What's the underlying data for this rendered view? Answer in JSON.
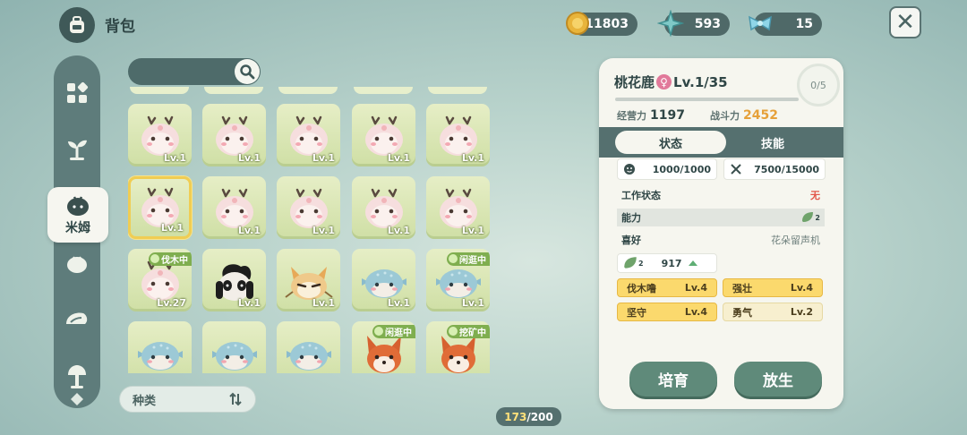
{
  "header": {
    "title": "背包",
    "currencies": [
      {
        "name": "gold-coin-icon",
        "value": "11803"
      },
      {
        "name": "star-shard-icon",
        "value": "593"
      },
      {
        "name": "bow-gem-icon",
        "value": "15"
      }
    ]
  },
  "sidebar": {
    "active_label": "米姆"
  },
  "search": {
    "placeholder": ""
  },
  "grid": {
    "items": [
      {
        "level": "Lv.1",
        "tag": "",
        "type": "deer"
      },
      {
        "level": "Lv.1",
        "tag": "",
        "type": "deer"
      },
      {
        "level": "Lv.1",
        "tag": "",
        "type": "deer"
      },
      {
        "level": "Lv.1",
        "tag": "",
        "type": "deer"
      },
      {
        "level": "Lv.1",
        "tag": "",
        "type": "deer"
      },
      {
        "level": "Lv.1",
        "tag": "",
        "type": "deer",
        "selected": true
      },
      {
        "level": "Lv.1",
        "tag": "",
        "type": "deer"
      },
      {
        "level": "Lv.1",
        "tag": "",
        "type": "deer"
      },
      {
        "level": "Lv.1",
        "tag": "",
        "type": "deer"
      },
      {
        "level": "Lv.1",
        "tag": "",
        "type": "deer"
      },
      {
        "level": "Lv.27",
        "tag": "伐木中",
        "type": "deer"
      },
      {
        "level": "Lv.1",
        "tag": "",
        "type": "panda"
      },
      {
        "level": "Lv.1",
        "tag": "",
        "type": "fox"
      },
      {
        "level": "Lv.1",
        "tag": "",
        "type": "whale"
      },
      {
        "level": "Lv.1",
        "tag": "闲逛中",
        "type": "whale"
      },
      {
        "level": "",
        "tag": "",
        "type": "whale"
      },
      {
        "level": "",
        "tag": "",
        "type": "whale"
      },
      {
        "level": "",
        "tag": "",
        "type": "whale"
      },
      {
        "level": "",
        "tag": "闲逛中",
        "type": "redfox"
      },
      {
        "level": "",
        "tag": "挖矿中",
        "type": "redfox"
      }
    ]
  },
  "sort": {
    "label": "种类"
  },
  "inventory": {
    "used": "173",
    "capacity": "/200"
  },
  "detail": {
    "name": "桃花鹿",
    "level": "Lv.1/35",
    "ring": "0/5",
    "manage_label": "经营力",
    "manage_value": "1197",
    "power_label": "战斗力",
    "power_value": "2452",
    "tab_status": "状态",
    "tab_skills": "技能",
    "mood_value": "1000/1000",
    "food_value": "7500/15000",
    "work_label": "工作状态",
    "work_value": "无",
    "ability_label": "能力",
    "ability_level": "2",
    "hobby_label": "喜好",
    "hobby_value": "花朵留声机",
    "ability_score_level": "2",
    "ability_score": "917",
    "skills": [
      {
        "name": "伐木噜",
        "level": "Lv.4"
      },
      {
        "name": "强壮",
        "level": "Lv.4"
      },
      {
        "name": "坚守",
        "level": "Lv.4"
      },
      {
        "name": "勇气",
        "level": "Lv.2"
      }
    ],
    "btn_breed": "培育",
    "btn_release": "放生"
  }
}
